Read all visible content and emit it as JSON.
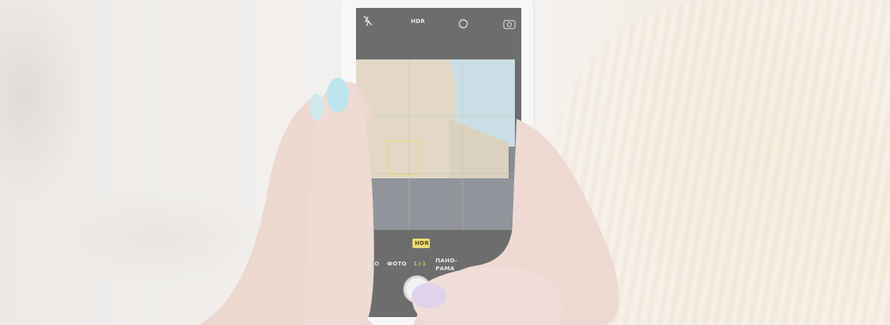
{
  "camera_ui": {
    "top_bar": {
      "hdr_label": "HDR"
    },
    "hdr_badge": "HDR",
    "modes": [
      "ЕО",
      "ФОТО",
      "1×1",
      "ПАНО-",
      "РАМА"
    ]
  },
  "colors": {
    "nail_blue": "#a9dde6",
    "nail_lavender": "#d7c3e6",
    "skin": "#e6c9c0",
    "screen": "#3b3a3a",
    "hdr_badge": "#e8cf4a"
  }
}
